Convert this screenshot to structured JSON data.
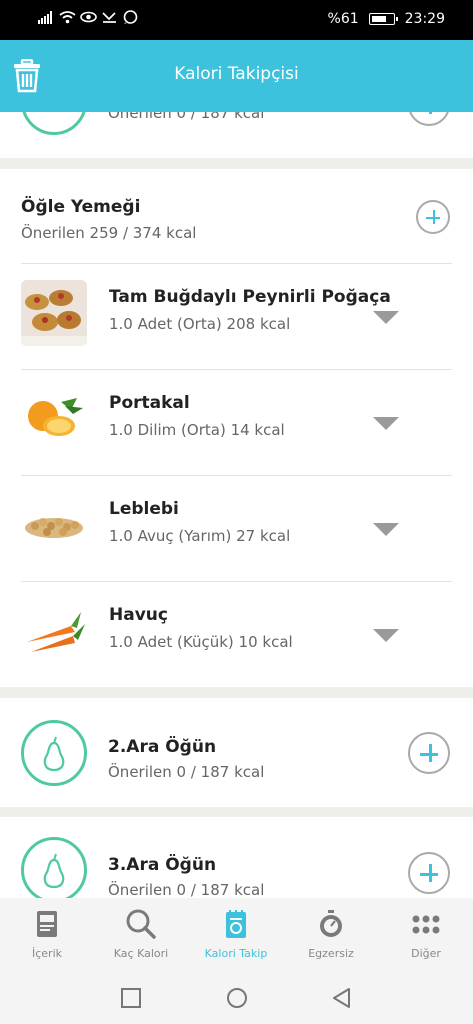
{
  "status": {
    "battery": "%61",
    "time": "23:29"
  },
  "app_bar": {
    "title": "Kalori Takipçisi",
    "icons": [
      "trash-icon"
    ]
  },
  "meals": {
    "morning_snack": {
      "subtitle": "Önerilen 0 / 187 kcal"
    },
    "lunch": {
      "title": "Öğle Yemeği",
      "subtitle": "Önerilen 259 / 374 kcal",
      "foods": [
        {
          "name": "Tam Buğdaylı Peynirli Poğaça",
          "detail": "1.0 Adet (Orta) 208 kcal",
          "icon": "pogaca-image"
        },
        {
          "name": "Portakal",
          "detail": "1.0 Dilim (Orta) 14 kcal",
          "icon": "orange-image"
        },
        {
          "name": "Leblebi",
          "detail": "1.0 Avuç (Yarım) 27 kcal",
          "icon": "chickpea-image"
        },
        {
          "name": "Havuç",
          "detail": "1.0 Adet (Küçük) 10 kcal",
          "icon": "carrot-image"
        }
      ]
    },
    "snack2": {
      "title": "2.Ara Öğün",
      "subtitle": "Önerilen 0 / 187 kcal"
    },
    "snack3": {
      "title": "3.Ara Öğün",
      "subtitle": "Önerilen 0 / 187 kcal"
    }
  },
  "bottom_nav": [
    {
      "label": "İçerik",
      "icon": "book-icon"
    },
    {
      "label": "Kaç Kalori",
      "icon": "search-icon"
    },
    {
      "label": "Kalori Takip",
      "icon": "tracker-icon"
    },
    {
      "label": "Egzersiz",
      "icon": "stopwatch-icon"
    },
    {
      "label": "Diğer",
      "icon": "grid-dots-icon"
    }
  ],
  "colors": {
    "accent": "#3cc2dc",
    "meal_icon": "#4ec9a0",
    "background": "#eeeeea"
  }
}
